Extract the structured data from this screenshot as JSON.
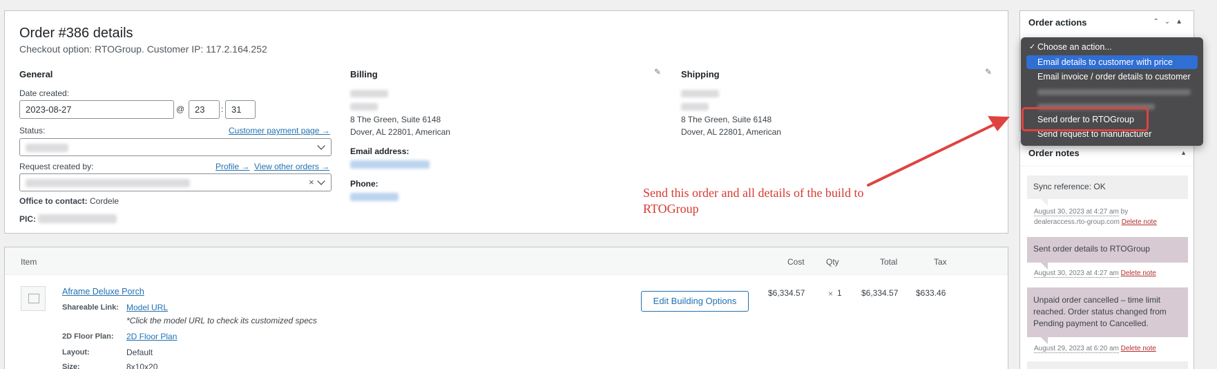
{
  "order": {
    "title": "Order #386 details",
    "subtitle": "Checkout option: RTOGroup. Customer IP: 117.2.164.252"
  },
  "general": {
    "heading": "General",
    "date_label": "Date created:",
    "date_value": "2023-08-27",
    "at": "@",
    "hour": "23",
    "colon": ":",
    "minute": "31",
    "status_label": "Status:",
    "customer_payment_link": "Customer payment page →",
    "request_label": "Request created by:",
    "profile_link": "Profile →",
    "view_orders_link": "View other orders →",
    "clear_symbol": "×",
    "office_label": "Office to contact:",
    "office_value": "Cordele",
    "pic_label": "PIC:"
  },
  "billing": {
    "heading": "Billing",
    "address_line1": "8 The Green, Suite 6148",
    "address_line2": "Dover, AL 22801, American",
    "email_label": "Email address:",
    "phone_label": "Phone:"
  },
  "shipping": {
    "heading": "Shipping",
    "address_line1": "8 The Green, Suite 6148",
    "address_line2": "Dover, AL 22801, American"
  },
  "items": {
    "headers": {
      "item": "Item",
      "cost": "Cost",
      "qty": "Qty",
      "total": "Total",
      "tax": "Tax"
    },
    "row": {
      "name": "Aframe Deluxe Porch",
      "shareable_label": "Shareable Link:",
      "model_url": "Model URL",
      "model_hint": "*Click the model URL to check its customized specs",
      "floor_label": "2D Floor Plan:",
      "floor_link": "2D Floor Plan",
      "layout_label": "Layout:",
      "layout_value": "Default",
      "size_label": "Size:",
      "size_value": "8x10x20",
      "edit_button": "Edit Building Options",
      "cost": "$6,334.57",
      "qty_x": "×",
      "qty": "1",
      "total": "$6,334.57",
      "tax": "$633.46"
    }
  },
  "actions": {
    "title": "Order actions",
    "dropdown": [
      {
        "label": "Choose an action...",
        "checked": true
      },
      {
        "label": "Email details to customer with price",
        "selected": true
      },
      {
        "label": "Email invoice / order details to customer"
      },
      {
        "label": "Send order to RTOGroup"
      },
      {
        "label": "Send request to manufacturer"
      }
    ],
    "check_glyph": "✓"
  },
  "notes": {
    "title": "Order notes",
    "items": [
      {
        "text": "Sync reference: OK",
        "date": "August 30, 2023 at 4:27 am",
        "by": " by",
        "author": "dealeraccess.rto-group.com",
        "delete": "Delete note"
      },
      {
        "text": "Sent order details to RTOGroup",
        "date": "August 30, 2023 at 4:27 am",
        "delete": "Delete note"
      },
      {
        "text": "Unpaid order cancelled – time limit reached. Order status changed from Pending payment to Cancelled.",
        "date": "August 29, 2023 at 6:20 am",
        "delete": "Delete note"
      }
    ]
  },
  "annotation": {
    "text": "Send this order and all details of the build to RTOGroup",
    "color": "#d63a2f"
  }
}
